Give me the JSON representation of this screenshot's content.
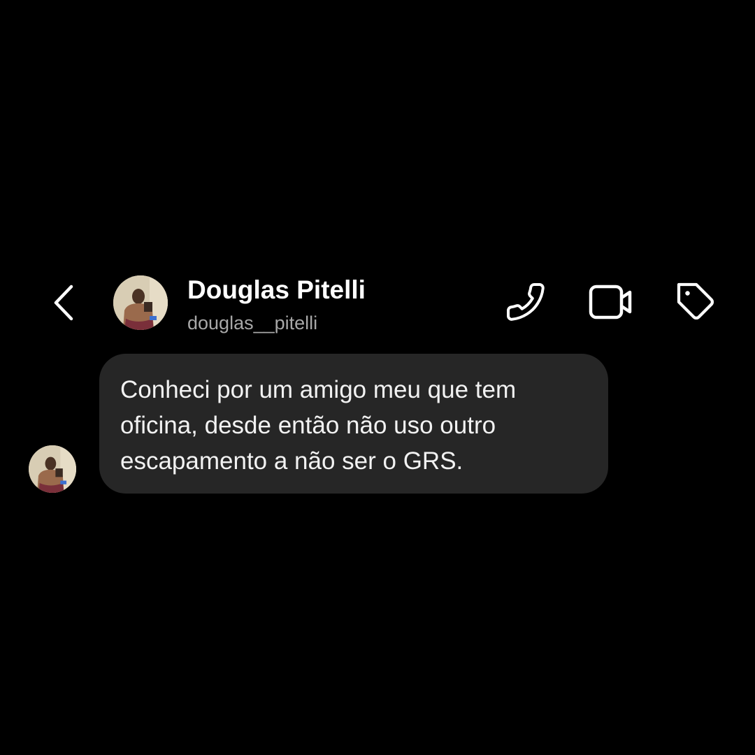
{
  "header": {
    "back_icon": "chevron-left-icon",
    "display_name": "Douglas Pitelli",
    "username": "douglas__pitelli",
    "actions": [
      {
        "name": "call",
        "icon": "phone-icon"
      },
      {
        "name": "video-call",
        "icon": "video-camera-icon"
      },
      {
        "name": "tag",
        "icon": "tag-icon"
      }
    ]
  },
  "messages": [
    {
      "sender": "douglas__pitelli",
      "text": "Conheci por um amigo meu que tem oficina, desde então não uso outro escapamento a não ser o GRS."
    }
  ],
  "colors": {
    "background": "#000000",
    "bubble": "#262626",
    "text": "#ffffff",
    "username": "#a8a8a8"
  }
}
